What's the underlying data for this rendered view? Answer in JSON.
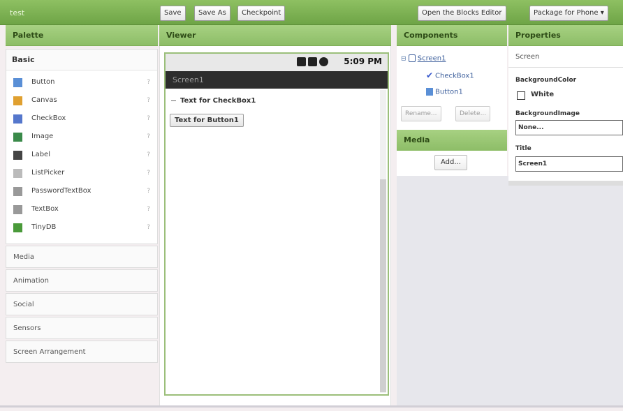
{
  "project": {
    "name": "test"
  },
  "toolbar": {
    "save": "Save",
    "save_as": "Save As",
    "checkpoint": "Checkpoint",
    "blocks_editor": "Open the Blocks Editor",
    "package": "Package for Phone ▾"
  },
  "columns": {
    "palette": "Palette",
    "viewer": "Viewer",
    "components": "Components",
    "properties": "Properties"
  },
  "palette": {
    "basic_label": "Basic",
    "basic_items": [
      {
        "label": "Button",
        "icon": "button-icon",
        "color": "#5a8fd6"
      },
      {
        "label": "Canvas",
        "icon": "canvas-icon",
        "color": "#e0a030"
      },
      {
        "label": "CheckBox",
        "icon": "checkbox-icon",
        "color": "#5577cc"
      },
      {
        "label": "Image",
        "icon": "image-icon",
        "color": "#3a8a4a"
      },
      {
        "label": "Label",
        "icon": "label-icon",
        "color": "#444444"
      },
      {
        "label": "ListPicker",
        "icon": "listpicker-icon",
        "color": "#bbbbbb"
      },
      {
        "label": "PasswordTextBox",
        "icon": "password-textbox-icon",
        "color": "#999999"
      },
      {
        "label": "TextBox",
        "icon": "textbox-icon",
        "color": "#999999"
      },
      {
        "label": "TinyDB",
        "icon": "tinydb-icon",
        "color": "#4a9a3a"
      }
    ],
    "help_glyph": "?",
    "drawers": [
      "Media",
      "Animation",
      "Social",
      "Sensors",
      "Screen Arrangement"
    ]
  },
  "viewer": {
    "time": "5:09 PM",
    "screen_title": "Screen1",
    "checkbox_text": "Text for CheckBox1",
    "button_text": "Text for Button1"
  },
  "components": {
    "tree": {
      "root": "Screen1",
      "children": [
        "CheckBox1",
        "Button1"
      ]
    },
    "rename": "Rename...",
    "delete": "Delete..."
  },
  "media": {
    "header": "Media",
    "add": "Add..."
  },
  "properties": {
    "component": "Screen",
    "bg_color_label": "BackgroundColor",
    "bg_color_value": "White",
    "bg_image_label": "BackgroundImage",
    "bg_image_value": "None...",
    "title_label": "Title",
    "title_value": "Screen1"
  },
  "colors": {
    "accent_green": "#8dbd67",
    "link_blue": "#3d5f9c"
  }
}
